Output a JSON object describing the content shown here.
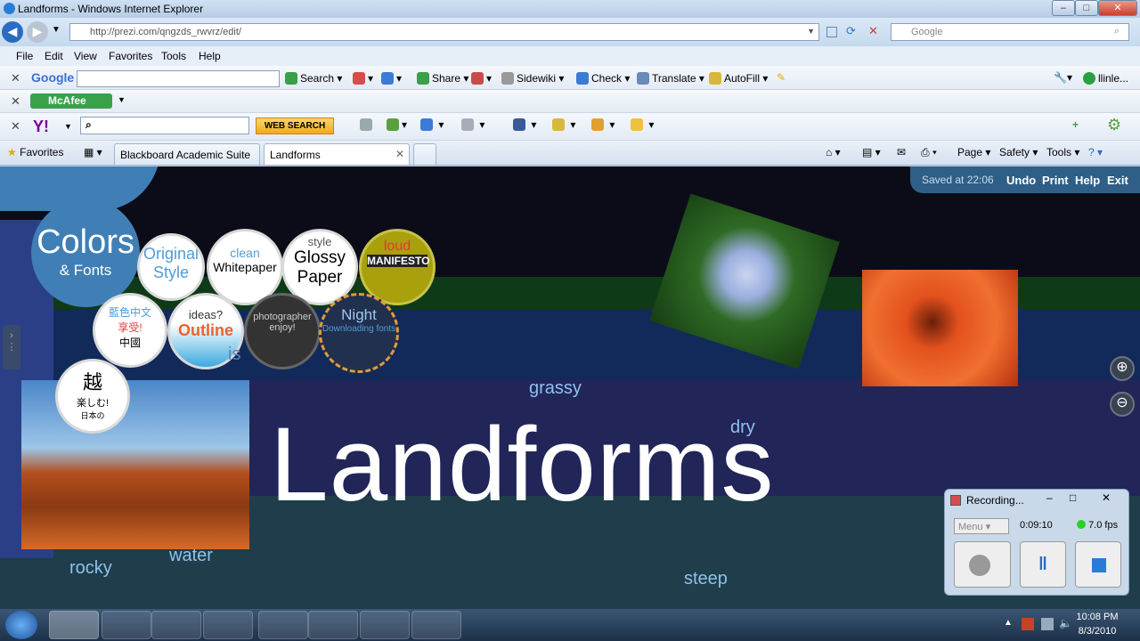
{
  "window": {
    "title": "Landforms - Windows Internet Explorer"
  },
  "address": {
    "url": "http://prezi.com/qngzds_rwvrz/edit/",
    "search_placeholder": "Google"
  },
  "menu": [
    "File",
    "Edit",
    "View",
    "Favorites",
    "Tools",
    "Help"
  ],
  "google_toolbar": {
    "brand": "Google",
    "search": "Search",
    "share": "Share",
    "sidewiki": "Sidewiki",
    "check": "Check",
    "translate": "Translate",
    "autofill": "AutoFill",
    "user": "llinle..."
  },
  "mcafee": {
    "label": "McAfee"
  },
  "yahoo": {
    "brand": "Y!",
    "web_search": "WEB SEARCH"
  },
  "favorites_bar": {
    "favorites": "Favorites",
    "tab1": "Blackboard Academic Suite",
    "tab2": "Landforms",
    "page": "Page",
    "safety": "Safety",
    "tools": "Tools"
  },
  "prezi": {
    "saved": "Saved at 22:06",
    "undo": "Undo",
    "print": "Print",
    "help": "Help",
    "exit": "Exit",
    "colors_title": "Colors",
    "colors_sub": "& Fonts",
    "styles": [
      {
        "line1": "Original",
        "line2": "Style"
      },
      {
        "line1": "clean",
        "line2": "Whitepaper"
      },
      {
        "line1": "style",
        "line2": "Glossy",
        "line3": "Paper"
      },
      {
        "line1": "loud",
        "line2": "MANIFESTO"
      },
      {
        "line1": "藍色中文",
        "line2": "享受!",
        "line3": "中國"
      },
      {
        "line1": "ideas?",
        "line2": "Outline"
      },
      {
        "line1": "photographer",
        "line2": "enjoy!"
      },
      {
        "line1": "Night",
        "line2": "Downloading fonts"
      },
      {
        "line1": "越",
        "line2": "楽しむ!",
        "line3": "日本の"
      }
    ],
    "main_title": "Landforms",
    "words": {
      "grassy": "grassy",
      "dry": "dry",
      "rocky": "rocky",
      "water": "water",
      "steep": "steep",
      "partial": "is"
    }
  },
  "recorder": {
    "title": "Recording...",
    "menu": "Menu",
    "time": "0:09:10",
    "fps": "7.0 fps"
  },
  "clock": {
    "time": "10:08 PM",
    "date": "8/3/2010"
  },
  "colors": {
    "canvas": "#0c0c18",
    "prezi_blue": "#2f5f86",
    "accent_text": "#8ec2ee",
    "flower": "#e3511d"
  }
}
